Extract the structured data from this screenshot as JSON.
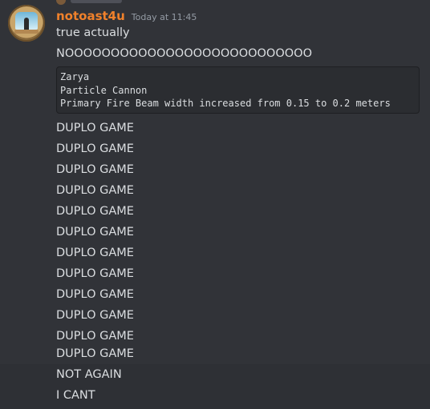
{
  "message": {
    "username": "notoast4u",
    "timestamp": "Today at 11:45",
    "username_color": "#f0812b",
    "lines_before_code": [
      "true actually",
      "NOOOOOOOOOOOOOOOOOOOOOOOOOOO"
    ],
    "code_block": [
      "Zarya",
      "Particle Cannon",
      "Primary Fire Beam width increased from 0.15 to 0.2 meters"
    ],
    "lines_after_code": [
      "DUPLO GAME",
      "DUPLO GAME",
      "DUPLO GAME",
      "DUPLO GAME",
      "DUPLO GAME",
      "DUPLO GAME",
      "DUPLO GAME",
      "DUPLO GAME",
      "DUPLO GAME",
      "DUPLO GAME",
      "DUPLO GAME",
      "DUPLO GAME",
      "NOT AGAIN",
      "I CANT"
    ]
  },
  "theme": {
    "background": "#313338",
    "code_background": "#2b2d31",
    "text": "#dbdee1",
    "muted": "#949ba4"
  }
}
